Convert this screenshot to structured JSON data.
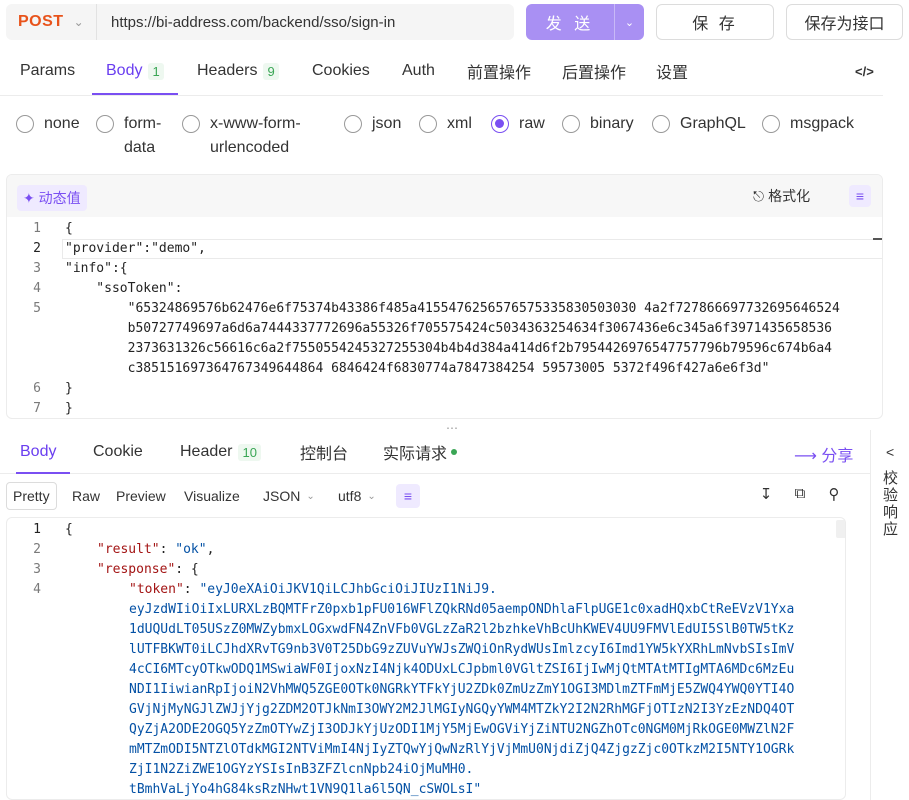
{
  "request": {
    "method": "POST",
    "url": "https://bi-address.com/backend/sso/sign-in",
    "send_label": "发 送",
    "save_label": "保 存",
    "save_as_api_label": "保存为接口"
  },
  "request_tabs": [
    {
      "label": "Params"
    },
    {
      "label": "Body",
      "badge": "1",
      "active": true
    },
    {
      "label": "Headers",
      "badge": "9"
    },
    {
      "label": "Cookies"
    },
    {
      "label": "Auth"
    },
    {
      "label": "前置操作"
    },
    {
      "label": "后置操作"
    },
    {
      "label": "设置"
    }
  ],
  "code_toggle_icon": "</>",
  "body_types": [
    {
      "label": "none"
    },
    {
      "label": "form-data",
      "line1": "form-",
      "line2": "data"
    },
    {
      "label": "x-www-form-urlencoded",
      "line1": "x-www-form-",
      "line2": "urlencoded"
    },
    {
      "label": "json"
    },
    {
      "label": "xml"
    },
    {
      "label": "raw",
      "selected": true
    },
    {
      "label": "binary"
    },
    {
      "label": "GraphQL"
    },
    {
      "label": "msgpack"
    }
  ],
  "request_editor": {
    "dynamic_value_label": "动态值",
    "format_label": "格式化",
    "line_numbers": [
      "1",
      "2",
      "",
      "3",
      "4",
      "5",
      "",
      "",
      "",
      "6",
      "7"
    ],
    "lines": [
      "{",
      "\"provider\":\"demo\",",
      "\"info\":{",
      "    \"ssoToken\":",
      "        \"65324869576b62476e6f75374b43386f485a4155476256576575335830503030",
      "        4a2f727866697732695646524b50727749697a6d6a7444337772696a55326f70",
      "        5575424c5034363254634f3067436e6c345a6f3971435658536237363132",
      "        6c56616c6a2f755055424532725530 4b4d384a414d6f2b7954426976547757796b79596c674b6a4c38515169736476733496448 6846424f6830774a7847384254 59573005 5372f496f427a6e6f3d\"",
      "}",
      "}"
    ],
    "display_lines": [
      "{",
      "\"provider\":\"demo\",",
      "\"info\":{",
      "    \"ssoToken\":",
      "        \"65324869576b62476e6f75374b43386f485a4155476256576575335830503030 4a2f727866697732695646524",
      "        b50727749697a6d6a7444337772696a55326f705575424c5034363254634f3067436e6c345a6f3971435658536",
      "        2373631326c56616c6a2f7550554245327255304b4b4d384a414d6f2b7954426976547757796b79596c674b6a4",
      "        c385151697364767349644864 6846424f6830774a7847384254 59573005 5372f496f427a6e6f3d\"",
      "}",
      "}"
    ]
  },
  "response_tabs": [
    {
      "label": "Body",
      "active": true
    },
    {
      "label": "Cookie"
    },
    {
      "label": "Header",
      "badge": "10"
    },
    {
      "label": "控制台"
    },
    {
      "label": "实际请求"
    }
  ],
  "share_label": "分享",
  "side_panel": {
    "label": "校验响应",
    "arrow": "<"
  },
  "view_modes": [
    "Pretty",
    "Raw",
    "Preview",
    "Visualize"
  ],
  "response_format": "JSON",
  "response_encoding": "utf8",
  "response_editor": {
    "line_numbers": [
      "1",
      "2",
      "3",
      "4"
    ],
    "key_result": "\"result\"",
    "val_result": "\"ok\"",
    "key_response": "\"response\"",
    "key_token": "\"token\"",
    "token_lines": [
      "\"eyJ0eXAiOiJKV1QiLCJhbGciOiJIUzI1NiJ9.",
      "eyJzdWIiOiIxLURXLzBQMTFrZ0pxb1pFU016WFlZQkRNd05aempONDhlaFlpUGE1c0xadHQxbCtReEVzV1Yxa",
      "1dUQUdLT05USzZ0MWZybmxLOGxwdFN4ZnVFb0VGLzZaR2l2bzhkeVhBcUhKWEV4UU9FMVlEdUI5SlB0TW5tKz",
      "lUTFBKWT0iLCJhdXRvTG9nb3V0T25DbG9zZUVuYWJsZWQiOnRydWUsImlzcyI6Imd1YW5kYXRhLmNvbSIsImV",
      "4cCI6MTcyOTkwODQ1MSwiaWF0IjoxNzI4Njk4ODUxLCJpbml0VGltZSI6IjIwMjQtMTAtMTIgMTA6MDc6MzEu",
      "NDI1IiwianRpIjoiN2VhMWQ5ZGE0OTk0NGRkYTFkYjU2ZDk0ZmUzZmY1OGI3MDlmZTFmMjE5ZWQ4YWQ0YTI4O",
      "GVjNjMyNGJlZWJjYjg2ZDM2OTJkNmI3OWY2M2JlMGIyNGQyYWM4MTZkY2I2N2RhMGFjOTIzN2I3YzEzNDQ4OT",
      "QyZjA2ODE2OGQ5YzZmOTYwZjI3ODJkYjUzODI1MjY5MjEwOGViYjZiNTU2NGZhOTc0NGM0MjRkOGE0MWZlN2F",
      "mMTZmODI5NTZlOTdkMGI2NTViMmI4NjIyZTQwYjQwNzRlYjVjMmU0NjdiZjQ4ZjgzZjc0OTkzM2I5NTY1OGRk",
      "ZjI1N2ZiZWE1OGYzYSIsInB3ZFZlcnNpb24iOjMuMH0.",
      "tBmhVaLjYo4hG84ksRzNHwt1VN9Q1la6l5QN_cSWOLsI\""
    ]
  }
}
